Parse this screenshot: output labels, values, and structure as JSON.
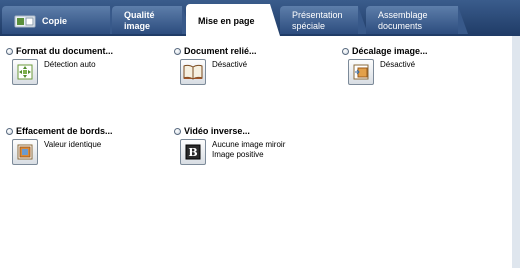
{
  "tabs": [
    {
      "label": "Copie"
    },
    {
      "label": "Qualité image"
    },
    {
      "label": "Mise en page"
    },
    {
      "label": "Présentation spéciale"
    },
    {
      "label": "Assemblage documents"
    }
  ],
  "features": [
    {
      "title": "Format du document...",
      "value_lines": [
        "Détection auto"
      ],
      "icon": "auto-detect-icon"
    },
    {
      "title": "Document relié...",
      "value_lines": [
        "Désactivé"
      ],
      "icon": "open-book-icon"
    },
    {
      "title": "Décalage image...",
      "value_lines": [
        "Désactivé"
      ],
      "icon": "image-shift-icon"
    },
    {
      "title": "Effacement de bords...",
      "value_lines": [
        "Valeur identique"
      ],
      "icon": "edge-erase-icon"
    },
    {
      "title": "Vidéo inverse...",
      "value_lines": [
        "Aucune image miroir",
        "Image positive"
      ],
      "icon": "mirror-image-icon"
    }
  ],
  "colors": {
    "tabbar": "#1f3b66",
    "tab": "#4a6b9a",
    "active_tab": "#ffffff"
  }
}
